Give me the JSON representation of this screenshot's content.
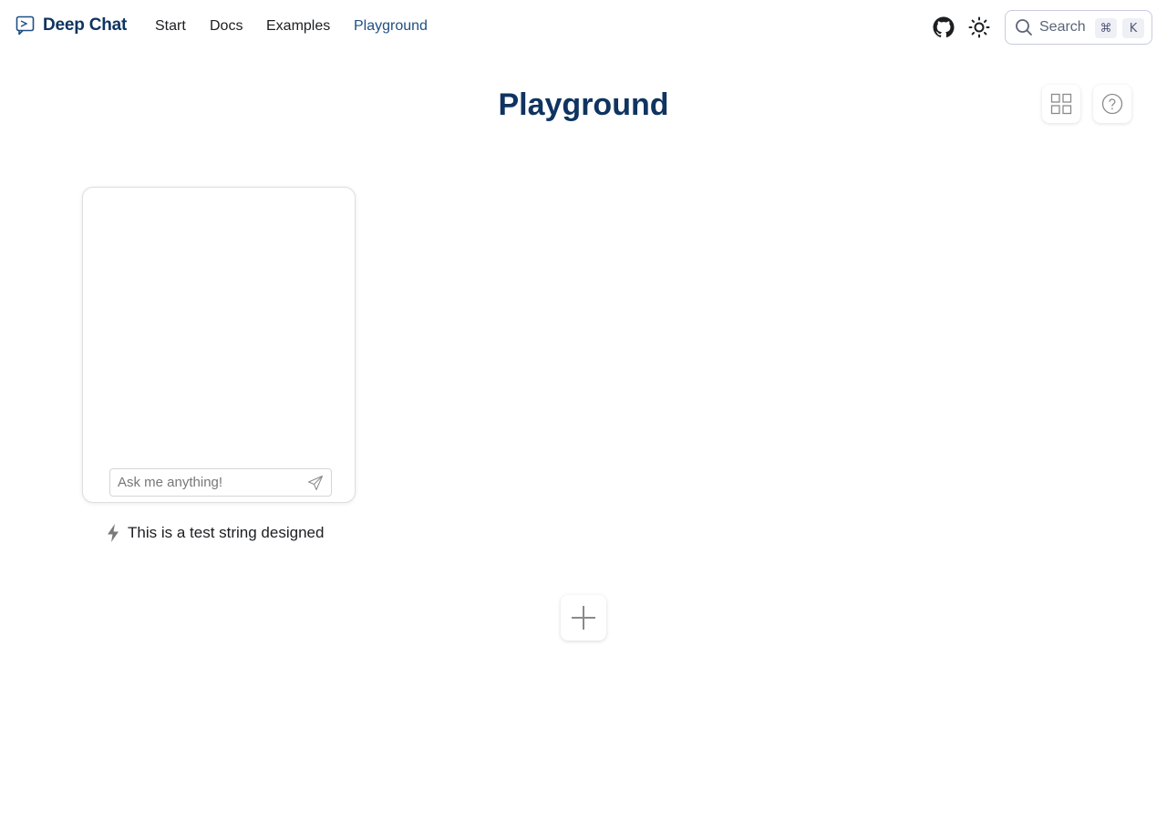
{
  "brand": {
    "title": "Deep Chat",
    "logo_icon": "chat-bubble-icon",
    "color": "#0f3460"
  },
  "nav": {
    "items": [
      {
        "label": "Start",
        "active": false
      },
      {
        "label": "Docs",
        "active": false
      },
      {
        "label": "Examples",
        "active": false
      },
      {
        "label": "Playground",
        "active": true
      }
    ]
  },
  "header_actions": {
    "github_icon": "github-icon",
    "theme_icon": "sun-icon",
    "search": {
      "label": "Search",
      "shortcut_mod": "⌘",
      "shortcut_key": "K"
    }
  },
  "page": {
    "title": "Playground"
  },
  "toolbar": {
    "layout_icon": "grid-layout-icon",
    "help_icon": "help-icon"
  },
  "chat_card": {
    "input_placeholder": "Ask me anything!",
    "send_icon": "send-icon",
    "caption": "This is a test string designed",
    "caption_icon": "bolt-icon"
  },
  "add_button": {
    "icon": "plus-icon"
  },
  "colors": {
    "title": "#0f3460",
    "active_nav": "#1f4f82",
    "border": "#dedede"
  }
}
